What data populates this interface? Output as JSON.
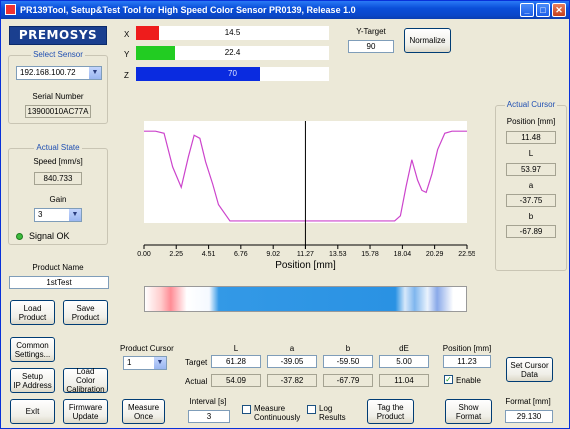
{
  "window": {
    "title": "PR139Tool, Setup&Test Tool for High Speed Color Sensor PR0139, Release 1.0"
  },
  "brand": {
    "logo": "PREMOSYS"
  },
  "sensor": {
    "group_title": "Select Sensor",
    "selected": "192.168.100.72",
    "serial_label": "Serial Number",
    "serial_value": "13900010AC77A"
  },
  "state": {
    "group_title": "Actual State",
    "speed_label": "Speed [mm/s]",
    "speed_value": "840.733",
    "gain_label": "Gain",
    "gain_value": "3",
    "signal_text": "Signal OK",
    "signal_color": "#3dbb3d"
  },
  "product": {
    "name_label": "Product Name",
    "name_value": "1stTest"
  },
  "buttons": {
    "load_product": "Load\nProduct",
    "save_product": "Save\nProduct",
    "common_settings": "Common\nSettings...",
    "setup_ip": "Setup\nIP Address",
    "load_color_cal": "Load Color\nCalibration",
    "exit": "ExIt",
    "firmware_update": "Firmware\nUpdate",
    "measure_once": "Measure\nOnce",
    "tag_product": "Tag the\nProduct",
    "show_format": "Show\nFormat",
    "set_cursor_data": "Set Cursor\nData",
    "normalize": "Normalize"
  },
  "xyz": {
    "bars": [
      {
        "label": "X",
        "value": "14.5",
        "fraction": 0.12,
        "color": "#ee1c1c"
      },
      {
        "label": "Y",
        "value": "22.4",
        "fraction": 0.2,
        "color": "#22cc22"
      },
      {
        "label": "Z",
        "value": "70",
        "fraction": 0.64,
        "color": "#0a2be0"
      }
    ],
    "y_target_label": "Y-Target",
    "y_target_value": "90"
  },
  "chart_data": {
    "type": "line",
    "xlabel": "Position [mm]",
    "xlim": [
      0.0,
      22.55
    ],
    "ylim": [
      0,
      1
    ],
    "grid": false,
    "x_ticks": [
      "0.00",
      "2.25",
      "4.51",
      "6.76",
      "9.02",
      "11.27",
      "13.53",
      "15.78",
      "18.04",
      "20.29",
      "22.55"
    ],
    "cursor_x": 11.27,
    "series": [
      {
        "color": "#cc44cc",
        "x": [
          0.0,
          0.8,
          1.4,
          2.0,
          2.6,
          3.1,
          3.5,
          3.9,
          4.3,
          4.8,
          5.2,
          6.0,
          9.0,
          12.0,
          15.0,
          17.5,
          17.9,
          18.3,
          18.7,
          19.1,
          19.4,
          19.7,
          20.1,
          20.5,
          21.0,
          21.5,
          22.0,
          22.55
        ],
        "y": [
          0.9,
          0.9,
          0.88,
          0.55,
          0.35,
          0.65,
          0.86,
          0.83,
          0.6,
          0.38,
          0.18,
          0.02,
          0.02,
          0.02,
          0.02,
          0.02,
          0.07,
          0.36,
          0.62,
          0.42,
          0.32,
          0.3,
          0.48,
          0.72,
          0.88,
          0.9,
          0.9,
          0.9
        ]
      }
    ]
  },
  "color_strip": {
    "stops": [
      {
        "pos": 0.0,
        "color": "#ffffff"
      },
      {
        "pos": 0.05,
        "color": "#ffcccc"
      },
      {
        "pos": 0.08,
        "color": "#ff8c95"
      },
      {
        "pos": 0.13,
        "color": "#ffffff"
      },
      {
        "pos": 0.2,
        "color": "#f5f9ff"
      },
      {
        "pos": 0.23,
        "color": "#3399e6"
      },
      {
        "pos": 0.78,
        "color": "#2a92e3"
      },
      {
        "pos": 0.81,
        "color": "#d7e8fa"
      },
      {
        "pos": 0.84,
        "color": "#7fb6ee"
      },
      {
        "pos": 0.88,
        "color": "#eaf3fd"
      },
      {
        "pos": 0.91,
        "color": "#89a9e9"
      },
      {
        "pos": 0.96,
        "color": "#ffffff"
      },
      {
        "pos": 1.0,
        "color": "#ffffff"
      }
    ]
  },
  "actual_cursor": {
    "group_title": "Actual Cursor",
    "position_label": "Position [mm]",
    "position_value": "11.48",
    "l_label": "L",
    "l_value": "53.97",
    "a_label": "a",
    "a_value": "-37.75",
    "b_label": "b",
    "b_value": "-67.89"
  },
  "product_cursor": {
    "label": "Product Cursor",
    "value": "1"
  },
  "lab_table": {
    "headers": [
      "L",
      "a",
      "b",
      "dE",
      "Position [mm]"
    ],
    "target_label": "Target",
    "actual_label": "Actual",
    "target": [
      "61.28",
      "-39.05",
      "-59.50",
      "5.00",
      "11.23"
    ],
    "actual": [
      "54.09",
      "-37.82",
      "-67.79",
      "11.04"
    ],
    "enable_label": "Enable",
    "enable_checked": true
  },
  "interval": {
    "label": "Interval [s]",
    "value": "3"
  },
  "options": {
    "measure_continuously": "Measure\nContinuously",
    "log_results": "Log\nResults"
  },
  "format": {
    "label": "Format [mm]",
    "value": "29.130"
  }
}
